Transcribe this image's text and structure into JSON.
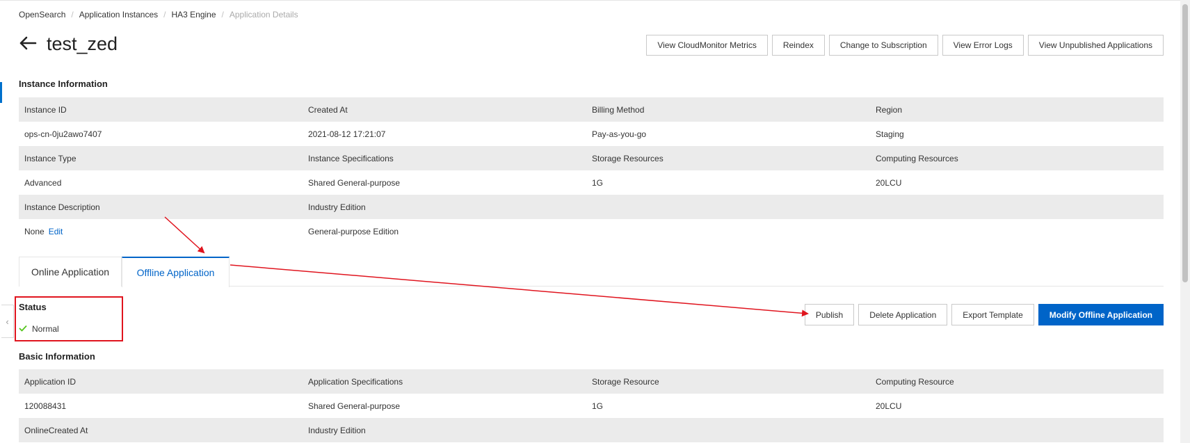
{
  "breadcrumb": {
    "items": [
      "OpenSearch",
      "Application Instances",
      "HA3 Engine",
      "Application Details"
    ],
    "separator": "/"
  },
  "header": {
    "title": "test_zed",
    "back_icon": "arrow-left-icon",
    "buttons": [
      "View CloudMonitor Metrics",
      "Reindex",
      "Change to Subscription",
      "View Error Logs",
      "View Unpublished Applications"
    ]
  },
  "instance_info": {
    "title": "Instance Information",
    "rows": [
      [
        "Instance ID",
        "Created At",
        "Billing Method",
        "Region"
      ],
      [
        "ops-cn-0ju2awo7407",
        "2021-08-12 17:21:07",
        "Pay-as-you-go",
        "Staging"
      ],
      [
        "Instance Type",
        "Instance Specifications",
        "Storage Resources",
        "Computing Resources"
      ],
      [
        "Advanced",
        "Shared General-purpose",
        "1G",
        "20LCU"
      ],
      [
        "Instance Description",
        "Industry Edition",
        "",
        ""
      ],
      [
        "None",
        "General-purpose Edition",
        "",
        ""
      ]
    ],
    "edit_link": "Edit"
  },
  "tabs": {
    "items": [
      "Online Application",
      "Offline Application"
    ],
    "active": "Offline Application"
  },
  "status": {
    "title": "Status",
    "value": "Normal",
    "icon": "check-icon",
    "color": "#52c41a"
  },
  "app_buttons": {
    "publish": "Publish",
    "delete": "Delete Application",
    "export": "Export Template",
    "modify": "Modify Offline Application"
  },
  "basic_info": {
    "title": "Basic Information",
    "rows": [
      [
        "Application ID",
        "Application Specifications",
        "Storage Resource",
        "Computing Resource"
      ],
      [
        "120088431",
        "Shared General-purpose",
        "1G",
        "20LCU"
      ],
      [
        "OnlineCreated At",
        "Industry Edition",
        "",
        ""
      ]
    ]
  },
  "colors": {
    "accent": "#0064c8",
    "annotation": "#e0141e",
    "row_shade": "#ebebeb"
  }
}
